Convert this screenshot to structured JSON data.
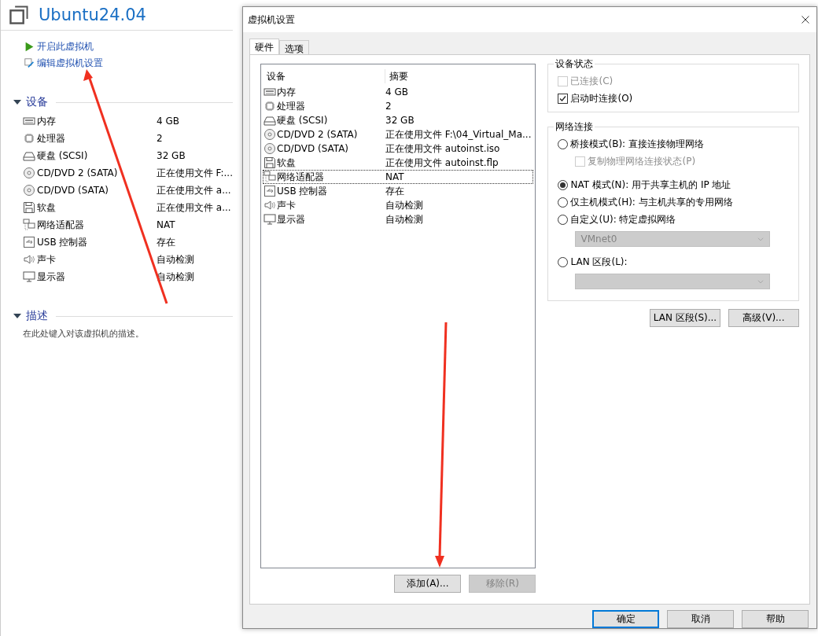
{
  "vm_panel": {
    "title": "Ubuntu24.04",
    "actions": [
      {
        "kind": "start",
        "label": "开启此虚拟机"
      },
      {
        "kind": "edit",
        "label": "编辑虚拟机设置"
      }
    ],
    "devices_section": {
      "title": "设备",
      "expanded": true,
      "items": [
        {
          "kind": "memory",
          "name": "内存",
          "summary": "4 GB"
        },
        {
          "kind": "cpu",
          "name": "处理器",
          "summary": "2"
        },
        {
          "kind": "disk",
          "name": "硬盘 (SCSI)",
          "summary": "32 GB"
        },
        {
          "kind": "cdrom",
          "name": "CD/DVD 2 (SATA)",
          "summary": "正在使用文件 F:..."
        },
        {
          "kind": "cdrom",
          "name": "CD/DVD (SATA)",
          "summary": "正在使用文件 a..."
        },
        {
          "kind": "floppy",
          "name": "软盘",
          "summary": "正在使用文件 a..."
        },
        {
          "kind": "network",
          "name": "网络适配器",
          "summary": "NAT"
        },
        {
          "kind": "usb",
          "name": "USB 控制器",
          "summary": "存在"
        },
        {
          "kind": "sound",
          "name": "声卡",
          "summary": "自动检测"
        },
        {
          "kind": "display",
          "name": "显示器",
          "summary": "自动检测"
        }
      ]
    },
    "description_section": {
      "title": "描述",
      "expanded": true,
      "text": "在此处键入对该虚拟机的描述。"
    }
  },
  "dialog": {
    "title": "虚拟机设置",
    "tabs": [
      {
        "label": "硬件",
        "selected": true
      },
      {
        "label": "选项",
        "selected": false
      }
    ],
    "device_list": {
      "columns": [
        "设备",
        "摘要"
      ],
      "rows": [
        {
          "kind": "memory",
          "device": "内存",
          "summary": "4 GB",
          "selected": false
        },
        {
          "kind": "cpu",
          "device": "处理器",
          "summary": "2",
          "selected": false
        },
        {
          "kind": "disk",
          "device": "硬盘 (SCSI)",
          "summary": "32 GB",
          "selected": false
        },
        {
          "kind": "cdrom",
          "device": "CD/DVD 2 (SATA)",
          "summary": "正在使用文件 F:\\04_Virtual_Ma...",
          "selected": false
        },
        {
          "kind": "cdrom",
          "device": "CD/DVD (SATA)",
          "summary": "正在使用文件 autoinst.iso",
          "selected": false
        },
        {
          "kind": "floppy",
          "device": "软盘",
          "summary": "正在使用文件 autoinst.flp",
          "selected": false
        },
        {
          "kind": "network",
          "device": "网络适配器",
          "summary": "NAT",
          "selected": true
        },
        {
          "kind": "usb",
          "device": "USB 控制器",
          "summary": "存在",
          "selected": false
        },
        {
          "kind": "sound",
          "device": "声卡",
          "summary": "自动检测",
          "selected": false
        },
        {
          "kind": "display",
          "device": "显示器",
          "summary": "自动检测",
          "selected": false
        }
      ]
    },
    "list_buttons": [
      {
        "label": "添加(A)...",
        "disabled": false
      },
      {
        "label": "移除(R)",
        "disabled": true
      }
    ],
    "device_status": {
      "title": "设备状态",
      "options": [
        {
          "label": "已连接(C)",
          "checked": false,
          "disabled": true
        },
        {
          "label": "启动时连接(O)",
          "checked": true,
          "disabled": false
        }
      ]
    },
    "network_connection": {
      "title": "网络连接",
      "options": [
        {
          "kind": "radio",
          "label": "桥接模式(B): 直接连接物理网络",
          "selected": false
        },
        {
          "kind": "checkbox",
          "label": "复制物理网络连接状态(P)",
          "checked": false,
          "disabled": true
        },
        {
          "kind": "radio",
          "label": "NAT 模式(N): 用于共享主机的 IP 地址",
          "selected": true
        },
        {
          "kind": "radio",
          "label": "仅主机模式(H): 与主机共享的专用网络",
          "selected": false
        },
        {
          "kind": "radio",
          "label": "自定义(U): 特定虚拟网络",
          "selected": false
        },
        {
          "kind": "dropdown",
          "value": "VMnet0",
          "disabled": true
        },
        {
          "kind": "radio",
          "label": "LAN 区段(L):",
          "selected": false
        },
        {
          "kind": "dropdown",
          "disabled": true
        }
      ]
    },
    "network_buttons": [
      "LAN 区段(S)...",
      "高级(V)..."
    ],
    "footer_buttons": [
      {
        "label": "确定",
        "default": true
      },
      {
        "label": "取消",
        "default": false
      },
      {
        "label": "帮助",
        "default": false
      }
    ]
  }
}
